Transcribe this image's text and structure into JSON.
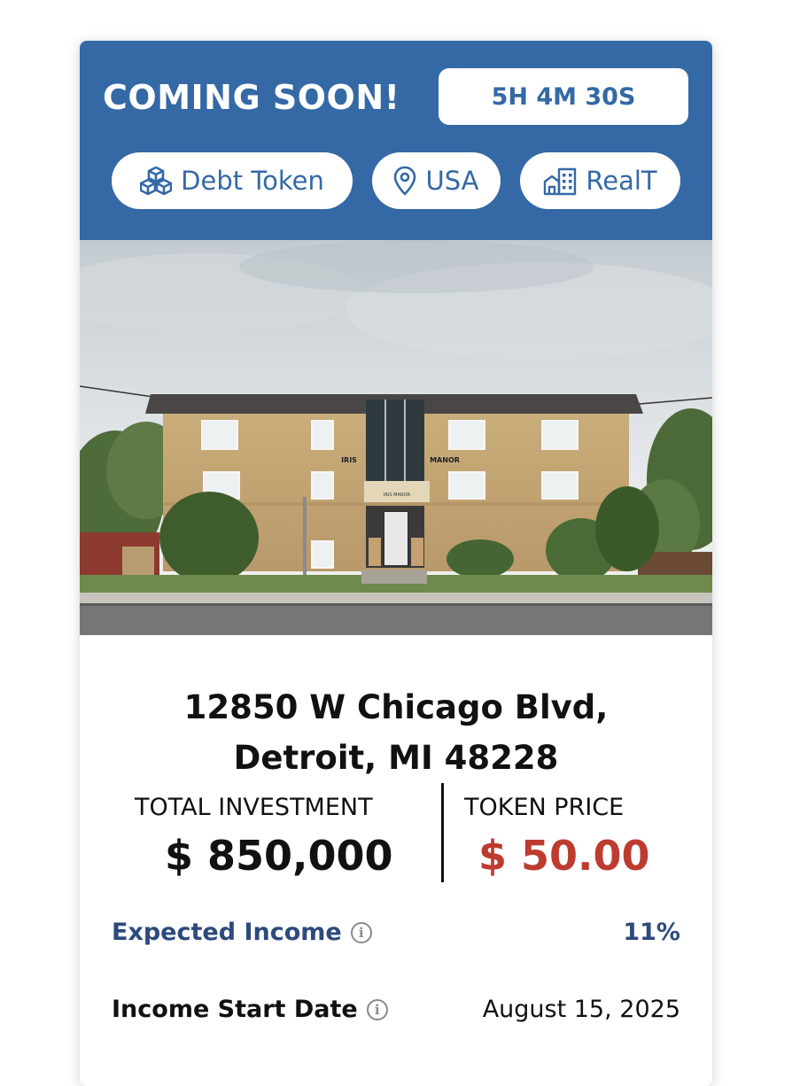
{
  "banner": {
    "status": "COMING SOON!",
    "countdown": "5H 4M 30S",
    "colors": {
      "header_bg": "#3469a6",
      "accent_red": "#bd3b2f",
      "label_blue": "#2c4a7c"
    }
  },
  "tags": [
    {
      "label": "Debt Token",
      "icon": "blocks-icon"
    },
    {
      "label": "USA",
      "icon": "location-pin-icon"
    },
    {
      "label": "RealT",
      "icon": "buildings-icon"
    }
  ],
  "photo": {
    "sign_text_left": "IRIS",
    "sign_text_right": "MANOR",
    "awning_text": "IRIS MANOR"
  },
  "property": {
    "address_line1": "12850 W Chicago Blvd,",
    "address_line2": "Detroit, MI 48228"
  },
  "stats": {
    "total_investment_label": "TOTAL INVESTMENT",
    "total_investment_value": "$ 850,000",
    "token_price_label": "TOKEN PRICE",
    "token_price_value": "$ 50.00"
  },
  "details": [
    {
      "label": "Expected Income",
      "value": "11%"
    },
    {
      "label": "Income Start Date",
      "value": "August 15, 2025"
    }
  ]
}
